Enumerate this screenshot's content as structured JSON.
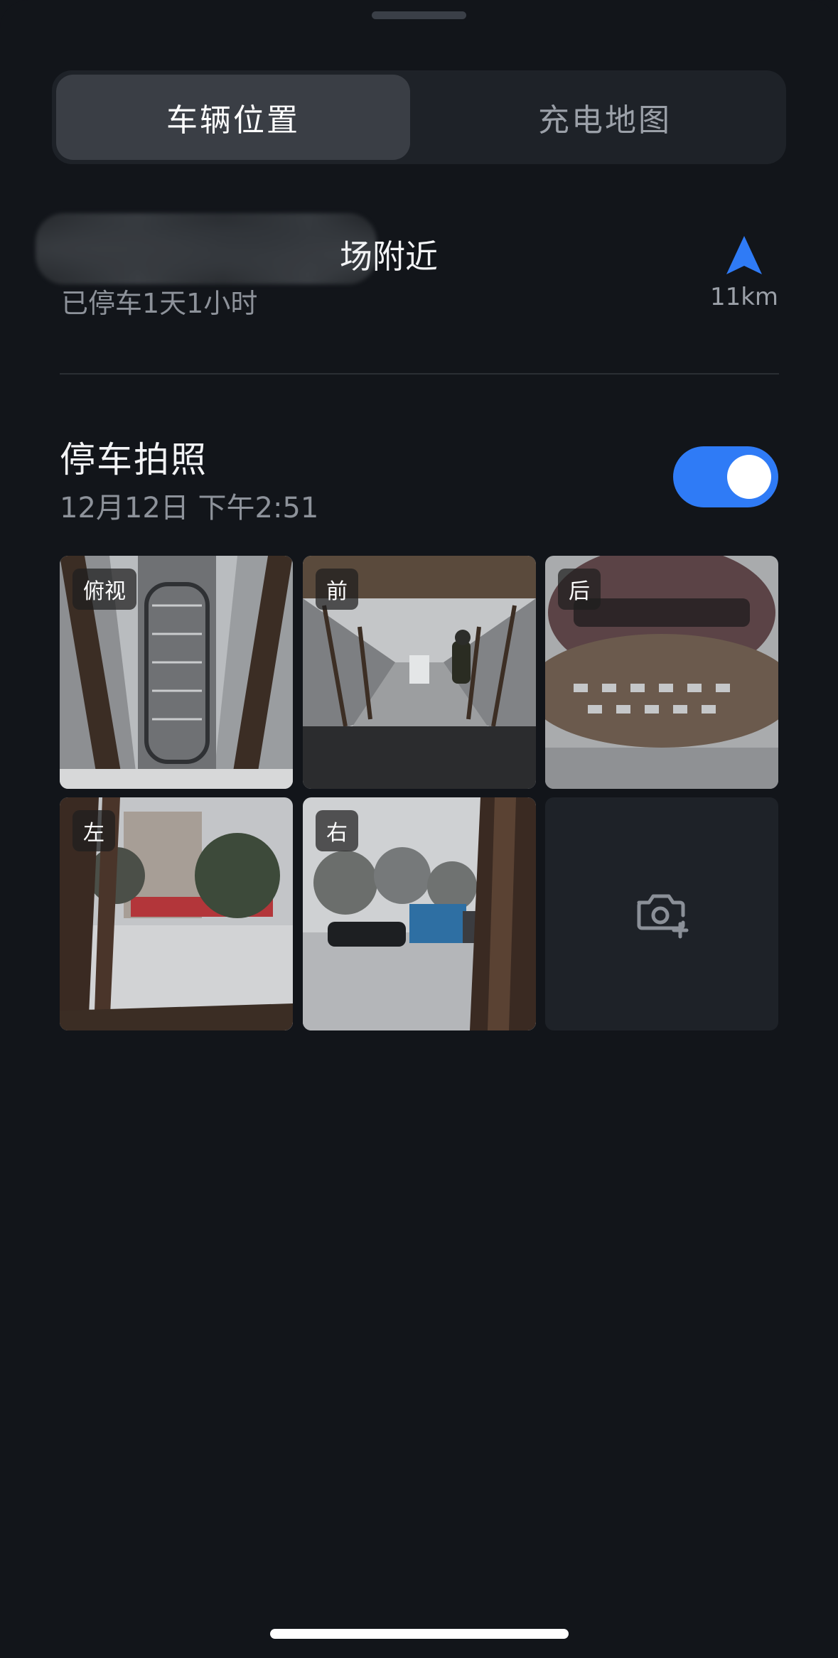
{
  "tabs": [
    {
      "label": "车辆位置",
      "active": true
    },
    {
      "label": "充电地图",
      "active": false
    }
  ],
  "location": {
    "name_suffix": "场附近",
    "parked_duration": "已停车1天1小时",
    "distance": "11km",
    "nav_icon": "navigation-arrow-icon"
  },
  "parking_photos": {
    "title": "停车拍照",
    "timestamp": "12月12日 下午2:51",
    "toggle_on": true,
    "accent_color": "#2f7bf6",
    "tiles": [
      {
        "label": "俯视"
      },
      {
        "label": "前"
      },
      {
        "label": "后"
      },
      {
        "label": "左"
      },
      {
        "label": "右"
      }
    ],
    "add_icon": "camera-plus-icon"
  }
}
